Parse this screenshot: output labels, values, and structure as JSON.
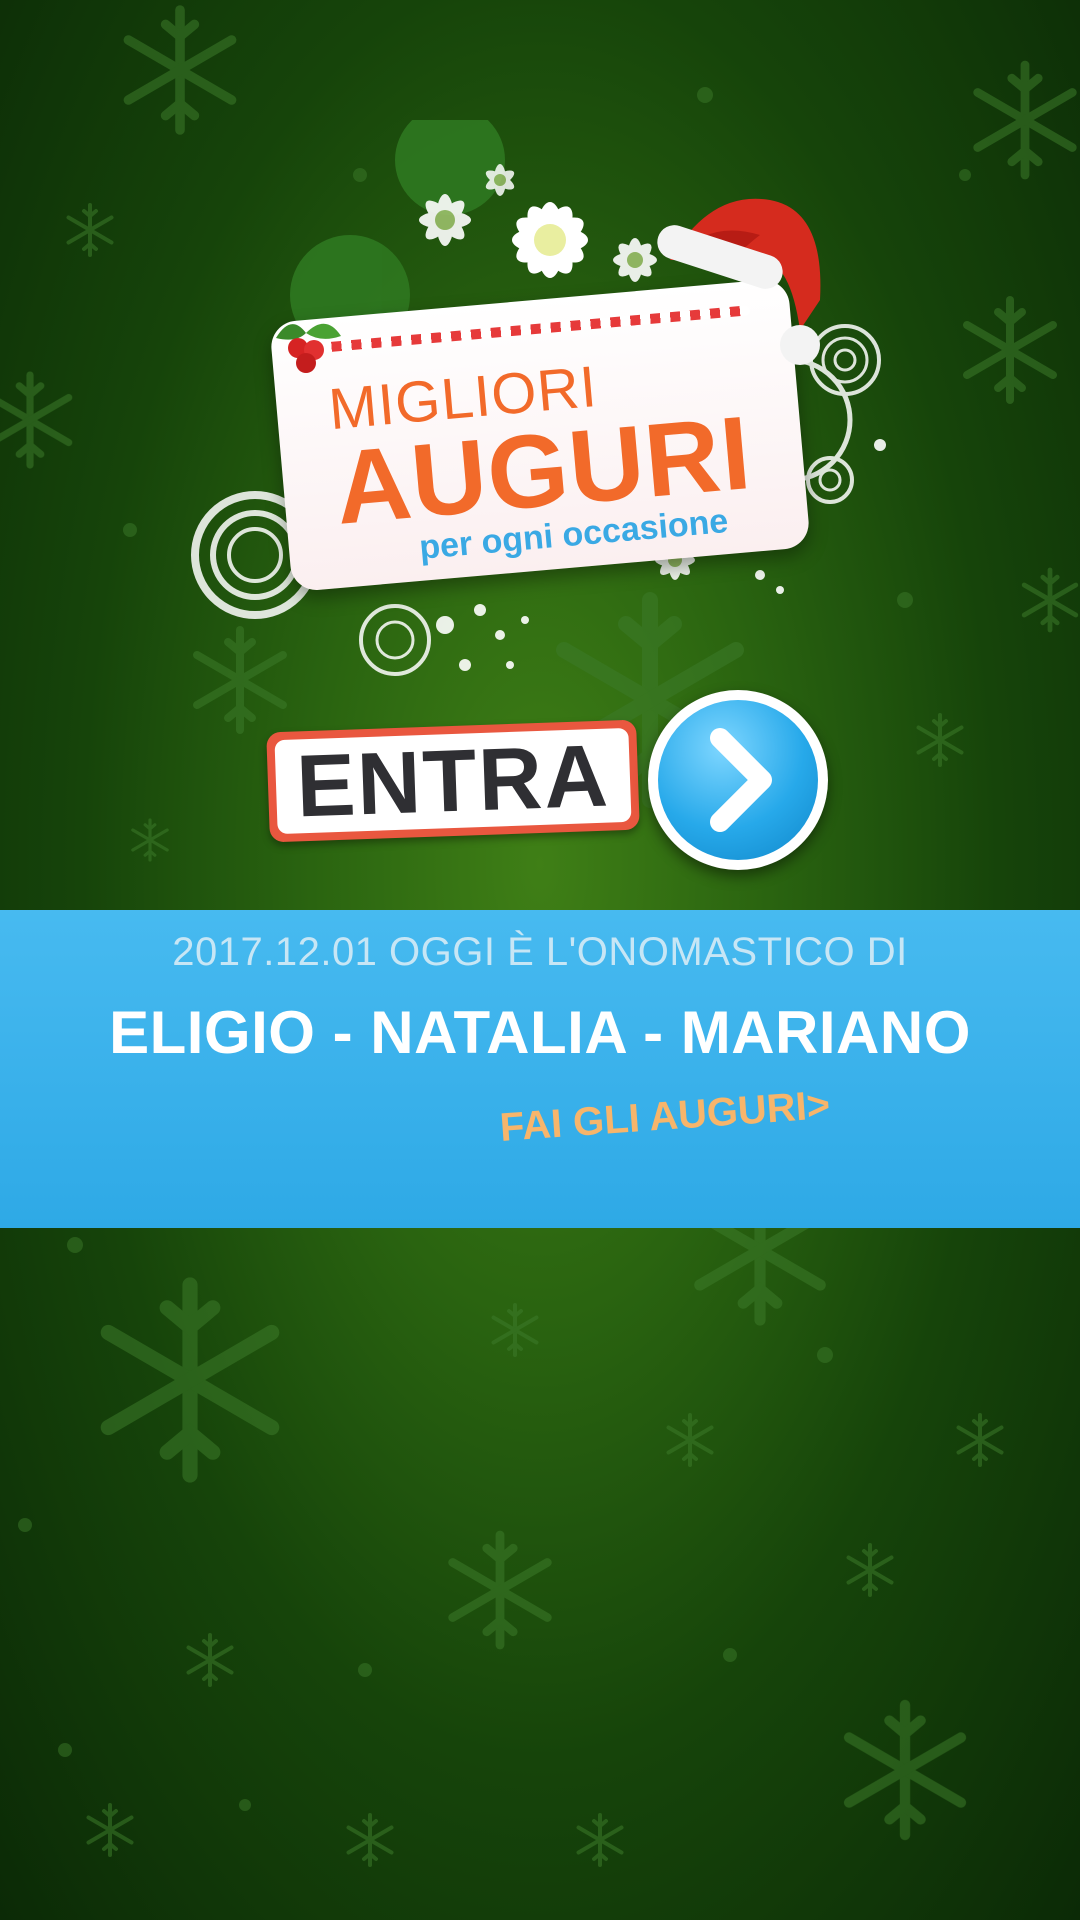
{
  "logo": {
    "title_line1": "MIGLIORI",
    "title_line2": "AUGURI",
    "tagline": "per ogni occasione"
  },
  "enter_button": {
    "label": "ENTRA",
    "icon": "chevron-right-icon"
  },
  "banner": {
    "date_text": "2017.12.01 OGGI È L'ONOMASTICO DI",
    "names_text": "ELIGIO - NATALIA - MARIANO",
    "cta_label": "FAI GLI AUGURI>"
  },
  "colors": {
    "background_green": "#2a6410",
    "banner_blue": "#3aaeea",
    "logo_orange": "#f26a2a",
    "tagline_blue": "#3aa9e4",
    "cta_orange": "#f7b56b",
    "entra_border": "#e9573f"
  }
}
